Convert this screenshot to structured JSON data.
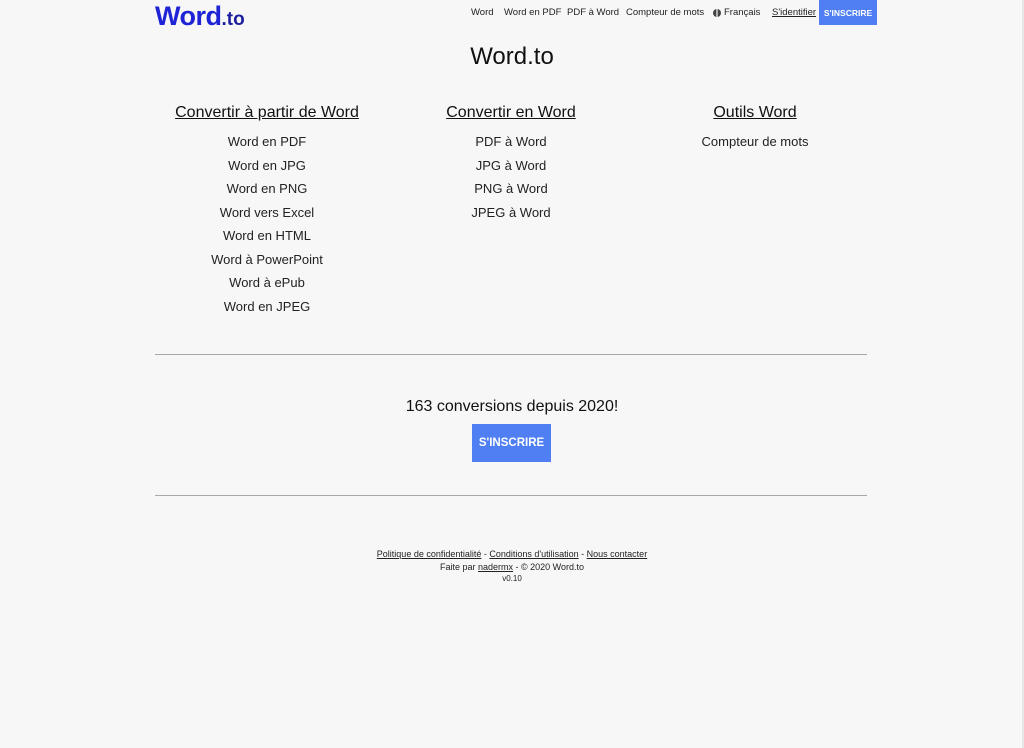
{
  "header": {
    "logo_main": "Word",
    "logo_suffix": ".to",
    "nav": [
      "Word",
      "Word en PDF",
      "PDF à Word",
      "Compteur de mots"
    ],
    "language": "Français",
    "login": "S'identifier",
    "signup": "S'INSCRIRE"
  },
  "title": "Word.to",
  "columns": [
    {
      "heading": "Convertir à partir de Word",
      "items": [
        "Word en PDF",
        "Word en JPG",
        "Word en PNG",
        "Word vers Excel",
        "Word en HTML",
        "Word à PowerPoint",
        "Word à ePub",
        "Word en JPEG"
      ]
    },
    {
      "heading": "Convertir en Word",
      "items": [
        "PDF à Word",
        "JPG à Word",
        "PNG à Word",
        "JPEG à Word"
      ]
    },
    {
      "heading": "Outils Word",
      "items": [
        "Compteur de mots"
      ]
    }
  ],
  "stats": {
    "text": "163 conversions depuis 2020!",
    "button": "S'INSCRIRE"
  },
  "footer": {
    "privacy": "Politique de confidentialité",
    "sep1": " - ",
    "terms": "Conditions d'utilisation",
    "sep2": " - ",
    "contact": "Nous contacter",
    "made_by_prefix": "Faite par ",
    "author": "nadermx",
    "copyright": " - © 2020 Word.to",
    "version": "v0.10"
  },
  "colors": {
    "accent": "#4f7ff2",
    "logo": "#1f23d6",
    "background": "#f7f7f7"
  }
}
